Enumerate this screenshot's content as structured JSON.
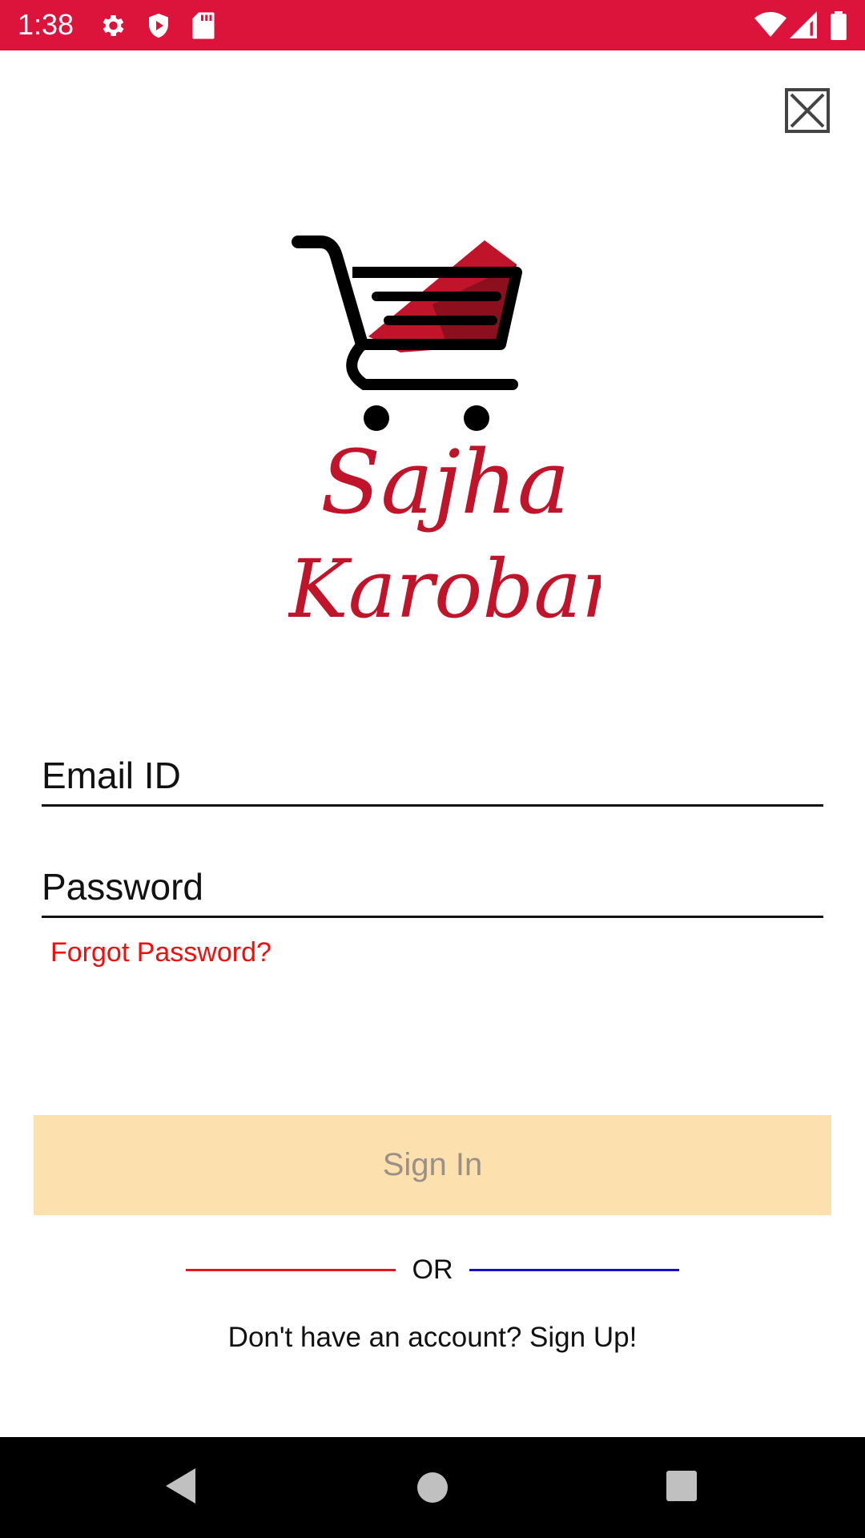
{
  "status_bar": {
    "time": "1:38",
    "background": "#dc143c",
    "left_icons": [
      "settings-gear-icon",
      "shield-play-icon",
      "sd-card-icon"
    ],
    "right_icons": [
      "wifi-icon",
      "cell-signal-icon",
      "battery-icon"
    ]
  },
  "header": {
    "close_icon": "close-x-icon"
  },
  "logo": {
    "line1": "Sajha",
    "line2": "Karobar",
    "brand_color": "#c0142a"
  },
  "form": {
    "email_placeholder": "Email ID",
    "password_placeholder": "Password",
    "forgot_password": "Forgot Password?",
    "sign_in_label": "Sign In",
    "or_text": "OR",
    "signup_prompt": "Don't have an account? Sign Up!"
  },
  "colors": {
    "accent_red": "#f40d0d",
    "sign_in_bg": "#fce0ad",
    "or_line_left": "#e8131d",
    "or_line_right": "#1010c8"
  },
  "nav_bar": {
    "buttons": [
      "back-icon",
      "home-icon",
      "recents-icon"
    ]
  }
}
